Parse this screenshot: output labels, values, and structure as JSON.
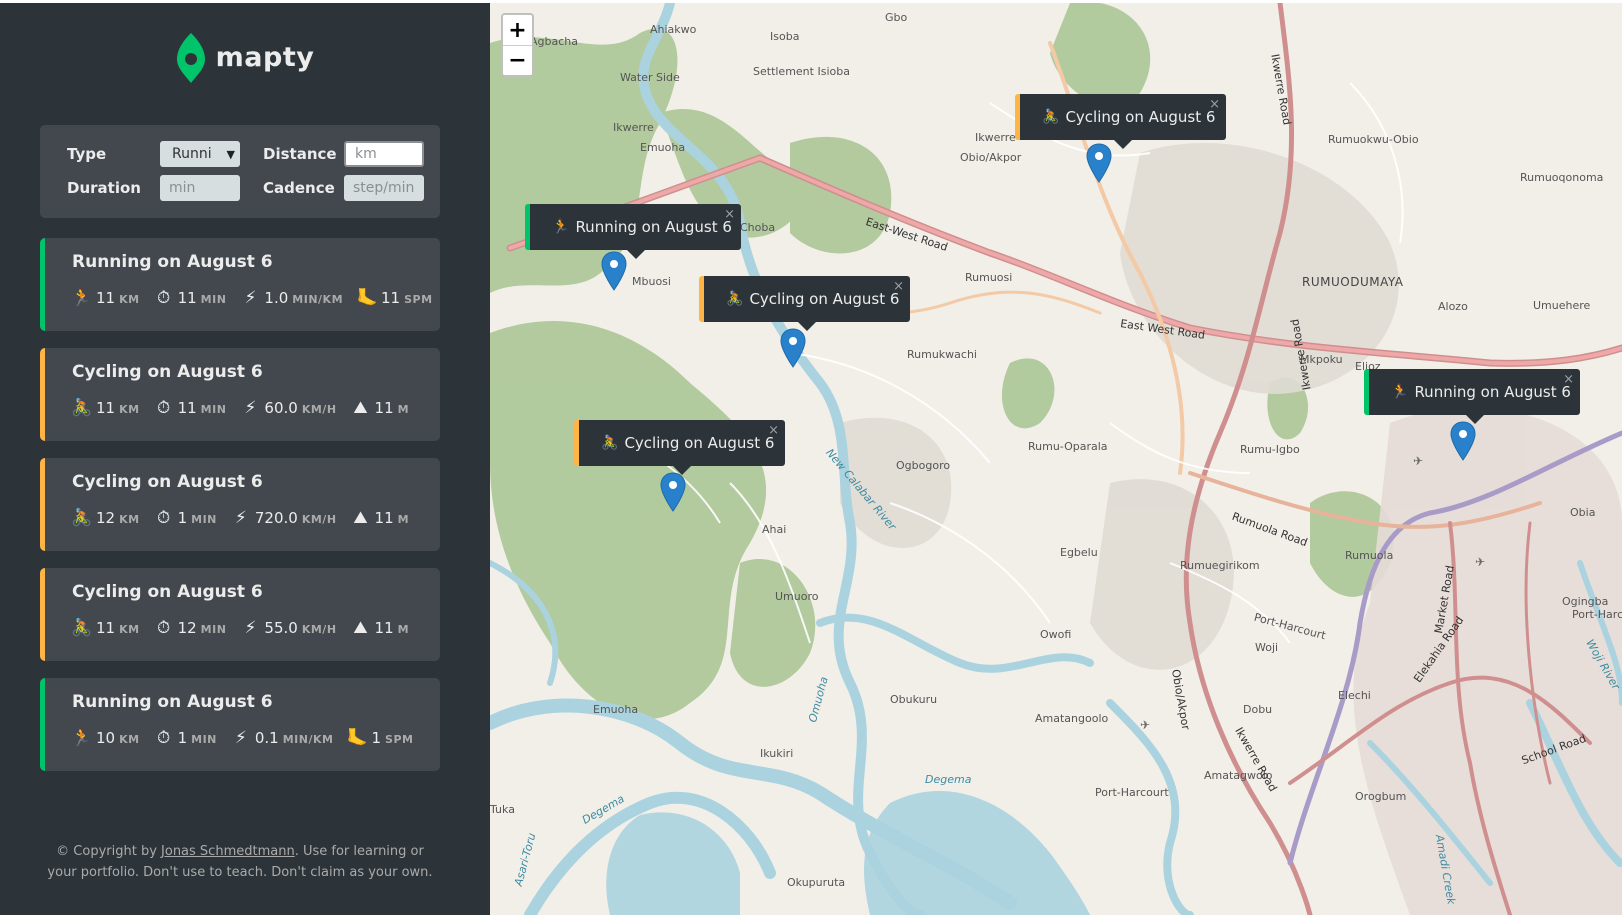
{
  "app": {
    "logo_text": "mapty"
  },
  "form": {
    "type_label": "Type",
    "type_value": "Runni",
    "distance_label": "Distance",
    "distance_placeholder": "km",
    "duration_label": "Duration",
    "duration_placeholder": "min",
    "cadence_label": "Cadence",
    "cadence_placeholder": "step/min"
  },
  "workouts": [
    {
      "type": "running",
      "title": "Running on August 6",
      "icon": "running-icon",
      "details": [
        {
          "icon": "🏃",
          "value": "11",
          "unit": "km"
        },
        {
          "icon": "⏱",
          "value": "11",
          "unit": "min"
        },
        {
          "icon": "⚡",
          "value": "1.0",
          "unit": "min/km"
        },
        {
          "icon": "🦶",
          "value": "11",
          "unit": "spm"
        }
      ]
    },
    {
      "type": "cycling",
      "title": "Cycling on August 6",
      "details": [
        {
          "icon": "🚴",
          "value": "11",
          "unit": "km"
        },
        {
          "icon": "⏱",
          "value": "11",
          "unit": "min"
        },
        {
          "icon": "⚡",
          "value": "60.0",
          "unit": "km/h"
        },
        {
          "icon": "⛰",
          "value": "11",
          "unit": "m"
        }
      ]
    },
    {
      "type": "cycling",
      "title": "Cycling on August 6",
      "details": [
        {
          "icon": "🚴",
          "value": "12",
          "unit": "km"
        },
        {
          "icon": "⏱",
          "value": "1",
          "unit": "min"
        },
        {
          "icon": "⚡",
          "value": "720.0",
          "unit": "km/h"
        },
        {
          "icon": "⛰",
          "value": "11",
          "unit": "m"
        }
      ]
    },
    {
      "type": "cycling",
      "title": "Cycling on August 6",
      "details": [
        {
          "icon": "🚴",
          "value": "11",
          "unit": "km"
        },
        {
          "icon": "⏱",
          "value": "12",
          "unit": "min"
        },
        {
          "icon": "⚡",
          "value": "55.0",
          "unit": "km/h"
        },
        {
          "icon": "⛰",
          "value": "11",
          "unit": "m"
        }
      ]
    },
    {
      "type": "running",
      "title": "Running on August 6",
      "details": [
        {
          "icon": "🏃",
          "value": "10",
          "unit": "km"
        },
        {
          "icon": "⏱",
          "value": "1",
          "unit": "min"
        },
        {
          "icon": "⚡",
          "value": "0.1",
          "unit": "min/km"
        },
        {
          "icon": "🦶",
          "value": "1",
          "unit": "spm"
        }
      ]
    }
  ],
  "copyright": {
    "prefix": "© Copyright by ",
    "author": "Jonas Schmedtmann",
    "suffix": ". Use for learning or your portfolio. Don't use to teach. Don't claim as your own."
  },
  "map": {
    "zoom_in": "+",
    "zoom_out": "−",
    "popups": [
      {
        "type": "cycling",
        "icon": "🚴",
        "label": "Cycling on August 6",
        "close": "×"
      },
      {
        "type": "running",
        "icon": "🏃",
        "label": "Running on August 6",
        "close": "×"
      },
      {
        "type": "cycling",
        "icon": "🚴",
        "label": "Cycling on August 6",
        "close": "×"
      },
      {
        "type": "cycling",
        "icon": "🚴",
        "label": "Cycling on August 6",
        "close": "×"
      },
      {
        "type": "running",
        "icon": "🏃",
        "label": "Running on August 6",
        "close": "×"
      }
    ],
    "labels": [
      "Gbo",
      "Isoba",
      "Ahiakwo",
      "Agbacha",
      "Water Side",
      "Settlement Isioba",
      "Emuoha",
      "Ikwerre",
      "Choba",
      "Mbuosi",
      "Obio/Akpor",
      "East-West Road",
      "Ikwerre",
      "Rumuosi",
      "Rumukwachi",
      "RUMUODUMAYA",
      "Alozo",
      "Rumuokwu-Obio",
      "Rumuoqonoma",
      "Umuehere",
      "Mkpoku",
      "Elioz",
      "Ogbogoro",
      "New Calabar River",
      "Rumu-Oparala",
      "Rumu-Igbo",
      "Ikwerre Road",
      "Egbelu",
      "Rumuegirikom",
      "Rumuola",
      "Rumuola Road",
      "Ahai",
      "Umuoro",
      "Owofi",
      "Port-Harcourt",
      "Woji",
      "Elechi",
      "Obia",
      "Ogingba",
      "Emuoha",
      "Obukuru",
      "Amatangoolo",
      "Dobu",
      "Amatagwolo",
      "Ikukiri",
      "Degema",
      "Port-Harcourt",
      "Orogbum",
      "School Road",
      "Market Road",
      "Elekahia Road",
      "Okupuruta",
      "Degema",
      "Asari-Toru",
      "Tuka",
      "Ikwerre Road",
      "East West Road",
      "Obio/Akpor",
      "Amadi Creek",
      "Woji River",
      "Port-Harc",
      "Omuoha",
      "Ikwerre Road"
    ]
  },
  "colors": {
    "sidebar_bg": "#2d3439",
    "card_bg": "#42484d",
    "running": "#00c46a",
    "cycling": "#ffb545",
    "marker": "#2a81cb"
  }
}
